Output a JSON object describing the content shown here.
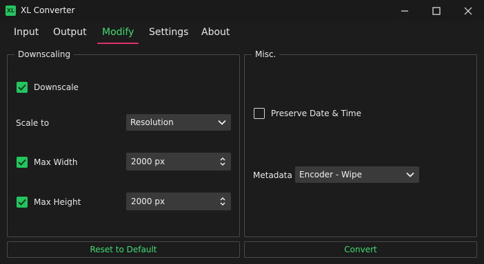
{
  "window": {
    "logo_text": "XL",
    "title": "XL Converter"
  },
  "tabs": [
    {
      "label": "Input",
      "active": false
    },
    {
      "label": "Output",
      "active": false
    },
    {
      "label": "Modify",
      "active": true
    },
    {
      "label": "Settings",
      "active": false
    },
    {
      "label": "About",
      "active": false
    }
  ],
  "downscaling": {
    "title": "Downscaling",
    "downscale": {
      "label": "Downscale",
      "checked": true
    },
    "scale_to": {
      "label": "Scale to",
      "value": "Resolution"
    },
    "max_width": {
      "label": "Max Width",
      "checked": true,
      "value": "2000 px"
    },
    "max_height": {
      "label": "Max Height",
      "checked": true,
      "value": "2000 px"
    }
  },
  "misc": {
    "title": "Misc.",
    "preserve_date_time": {
      "label": "Preserve Date & Time",
      "checked": false
    },
    "metadata": {
      "label": "Metadata",
      "value": "Encoder - Wipe"
    }
  },
  "buttons": {
    "reset": "Reset to Default",
    "convert": "Convert"
  },
  "colors": {
    "accent_green": "#22c55e",
    "active_tab_text": "#3ddc72",
    "tab_underline": "#e0306e",
    "background": "#1c1c1c"
  },
  "icons": {
    "logo": "xl-logo-icon",
    "minimize": "minimize-icon",
    "maximize": "maximize-icon",
    "close": "close-icon",
    "check": "check-icon",
    "dropdown": "chevron-down-icon",
    "spin": "spin-arrows-icon"
  }
}
